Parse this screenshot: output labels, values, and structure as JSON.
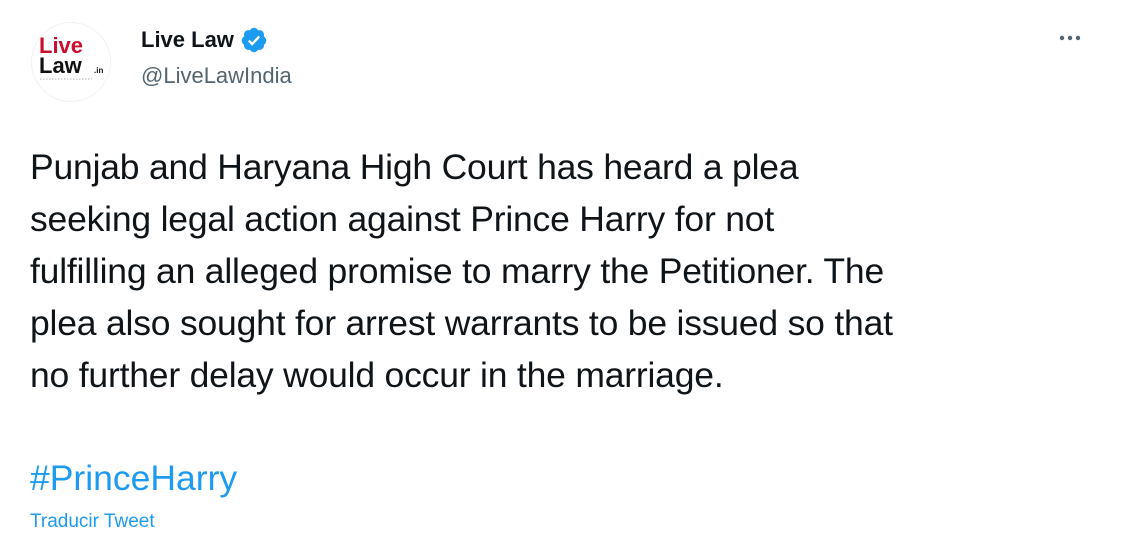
{
  "author": {
    "display_name": "Live Law",
    "handle": "@LiveLawIndia",
    "verified": true,
    "avatar": {
      "logo_text_top": "Live",
      "logo_text_bottom": "Law",
      "logo_suffix": ".in",
      "logo_top_color": "#c8102e",
      "logo_bottom_color": "#111111"
    }
  },
  "tweet": {
    "text": "Punjab and Haryana High Court has heard a plea\nseeking legal action against Prince Harry for not\nfulfilling an alleged promise to marry the Petitioner. The\nplea also sought for arrest warrants to be issued so that\nno further delay would occur in the marriage.",
    "hashtag": "#PrinceHarry",
    "translate_label": "Traducir Tweet"
  },
  "icons": {
    "verified": "verified-badge-icon",
    "more": "more-options-icon"
  },
  "colors": {
    "text": "#0f1419",
    "secondary": "#536471",
    "link": "#1d9bf0"
  }
}
